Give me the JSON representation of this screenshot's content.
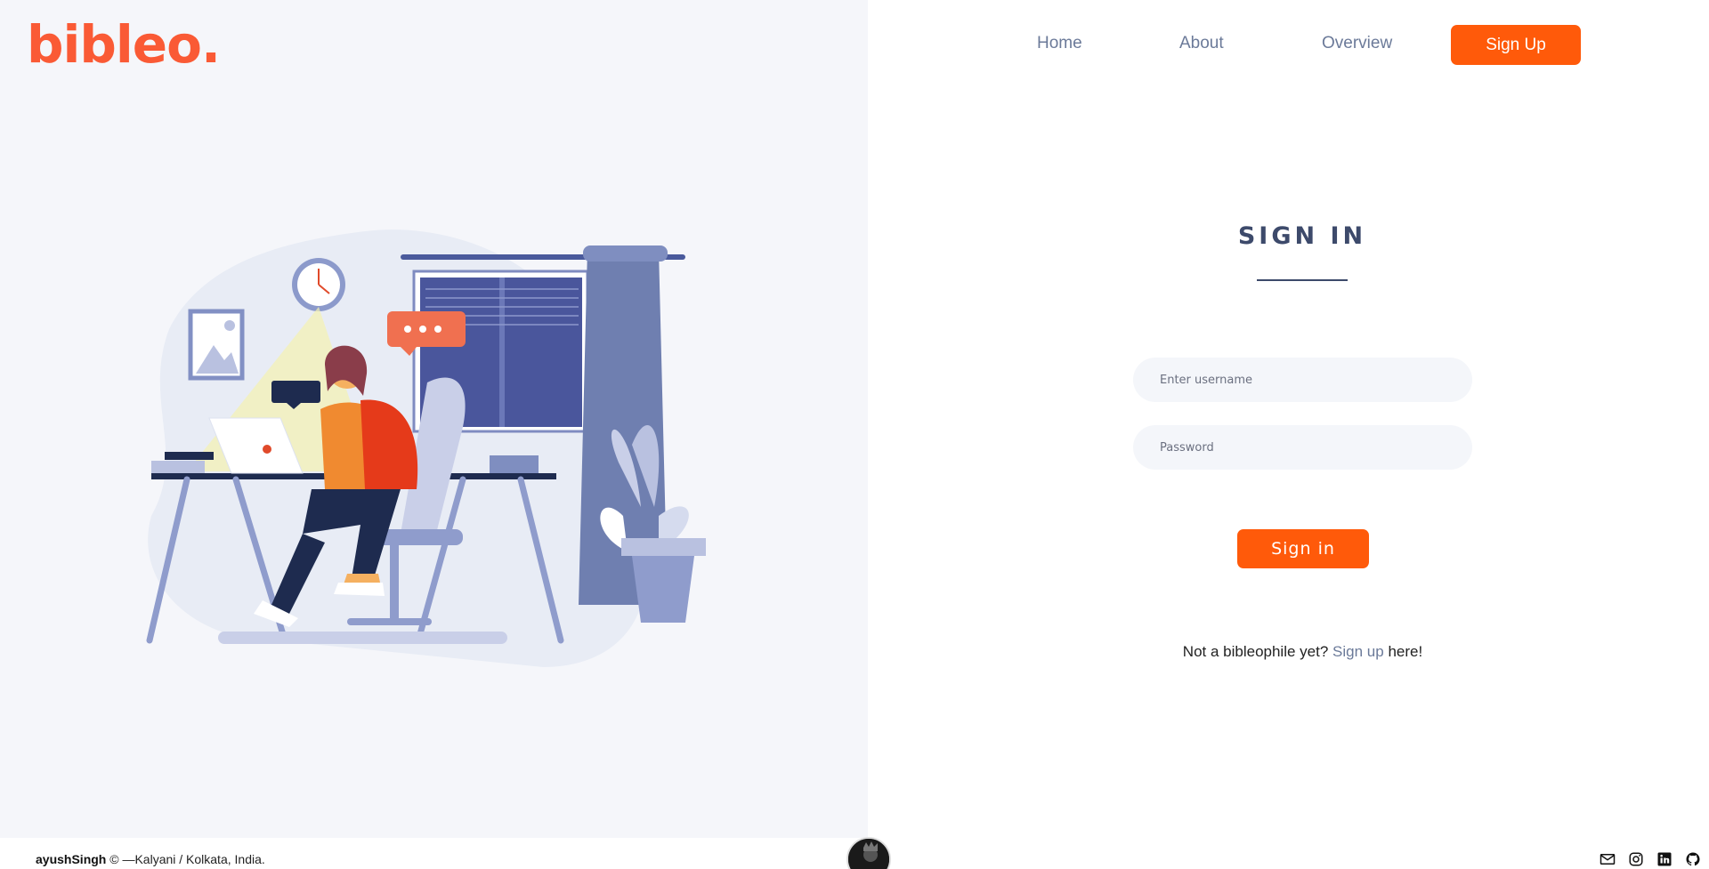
{
  "brand": {
    "logo_text": "bibleo."
  },
  "nav": {
    "home": "Home",
    "about": "About",
    "overview": "Overview",
    "signup": "Sign Up"
  },
  "form": {
    "title": "SIGN IN",
    "username_placeholder": "Enter username",
    "password_placeholder": "Password",
    "submit": "Sign in",
    "prompt_before": "Not a bibleophile yet?",
    "prompt_link": "Sign up",
    "prompt_after": "here!"
  },
  "footer": {
    "author": "ayushSingh",
    "rest": "© —Kalyani / Kolkata, India.",
    "social_icons": [
      "mail-icon",
      "instagram-icon",
      "linkedin-icon",
      "github-icon"
    ]
  },
  "colors": {
    "accent": "#ff5a0a",
    "logo": "#fa5a35",
    "heading": "#3d4a6b",
    "nav_text": "#6b7a99",
    "left_bg": "#f5f6fa"
  }
}
